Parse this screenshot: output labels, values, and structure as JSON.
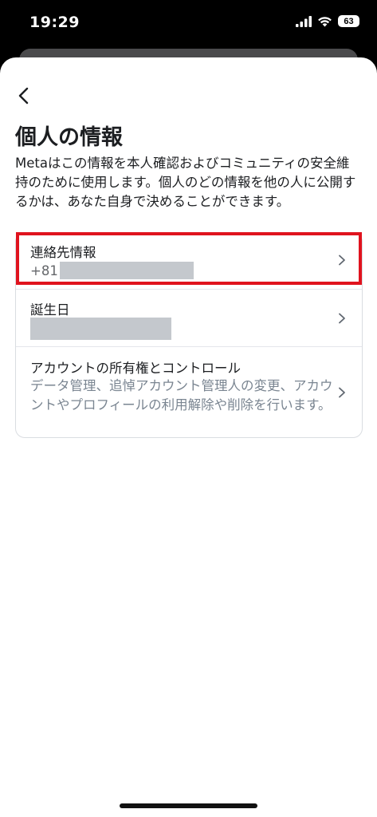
{
  "status_bar": {
    "time": "19:29",
    "battery": "63"
  },
  "header": {
    "back_icon": "chevron-left-icon",
    "title": "個人の情報"
  },
  "description": "Metaはこの情報を本人確認およびコミュニティの安全維持のために使用します。個人のどの情報を他の人に公開するかは、あなた自身で決めることができます。",
  "items": [
    {
      "title": "連絡先情報",
      "value_prefix": "+81",
      "value_redacted": true,
      "highlighted": true
    },
    {
      "title": "誕生日",
      "value_redacted": true
    },
    {
      "title": "アカウントの所有権とコントロール",
      "subtitle": "データ管理、追悼アカウント管理人の変更、アカウントやプロフィールの利用解除や削除を行います。"
    }
  ],
  "colors": {
    "highlight": "#e0131e",
    "redaction": "#c4c8cd",
    "subtitle": "#7a8591"
  }
}
